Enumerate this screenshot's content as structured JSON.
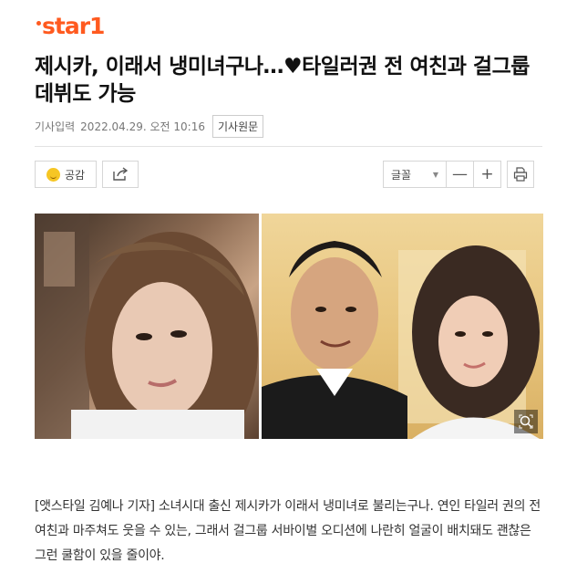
{
  "site": {
    "logo_text": "star1"
  },
  "article": {
    "headline": "제시카, 이래서 냉미녀구나…♥타일러권 전 여친과 걸그룹 데뷔도 가능",
    "meta_label": "기사입력",
    "date": "2022.04.29. 오전 10:16",
    "source_button": "기사원문",
    "body": "[앳스타일 김예나 기자] 소녀시대 출신 제시카가 이래서 냉미녀로 불리는구나. 연인 타일러 권의 전 여친과 마주쳐도 웃을 수 있는, 그래서 걸그룹 서바이벌 오디션에 나란히 얼굴이 배치돼도 괜찮은 그런 쿨함이 있을 줄이야."
  },
  "toolbar": {
    "like_label": "공감",
    "font_label": "글꼴",
    "decrease_label": "—",
    "increase_label": "+"
  },
  "icons": {
    "like": "smiley-icon",
    "share": "share-icon",
    "font_dropdown": "chevron-down-icon",
    "print": "print-icon",
    "zoom": "zoom-icon"
  },
  "colors": {
    "brand": "#ff5a1f"
  }
}
